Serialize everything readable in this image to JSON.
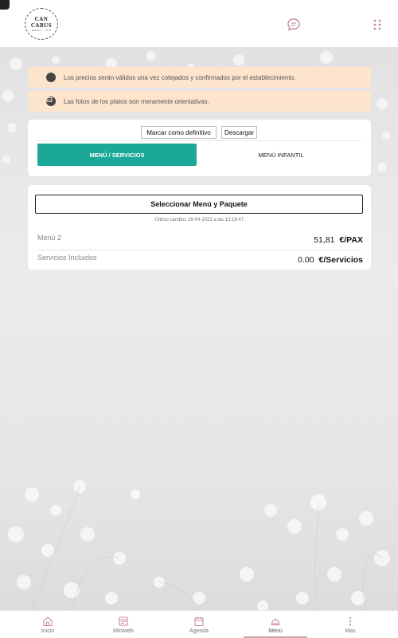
{
  "header": {
    "logo_line1": "CAN",
    "logo_line2": "CABUS",
    "logo_line3": "MASIA · 1843"
  },
  "notices": [
    {
      "icon": "moon-icon",
      "text": "Los precios serán válidos una vez cotejados y confirmados por el establecimiento."
    },
    {
      "icon": "image-icon",
      "text": "Las fotos de los platos son meramente orientativas."
    }
  ],
  "menu_card": {
    "mark_final_label": "Marcar como definitivo",
    "download_label": "Descargar",
    "tabs": [
      {
        "label": "MENÚ / SERVICIOS",
        "active": true
      },
      {
        "label": "MENÚ INFANTIL",
        "active": false
      }
    ]
  },
  "selection_card": {
    "select_button_label": "Seleccionar Menú y Paquete",
    "last_change": "Último cambio: 29-04-2022 a las 13:18:47",
    "rows": [
      {
        "label": "Menú 2",
        "amount": "51,81",
        "unit": "€/PAX"
      },
      {
        "label": "Servicios Incluidos",
        "amount": "0.00",
        "unit": "€/Servicios"
      }
    ]
  },
  "bottom_nav": [
    {
      "label": "Inicio",
      "icon": "home-icon",
      "active": false
    },
    {
      "label": "Miniweb",
      "icon": "miniweb-icon",
      "active": false
    },
    {
      "label": "Agenda",
      "icon": "calendar-icon",
      "active": false
    },
    {
      "label": "Menú",
      "icon": "cloche-icon",
      "active": true
    },
    {
      "label": "Mas",
      "icon": "more-vertical-icon",
      "active": false
    }
  ],
  "colors": {
    "accent_teal": "#1ca897",
    "notice_bg": "#fde4cc",
    "icon_pink": "#c98a94"
  }
}
